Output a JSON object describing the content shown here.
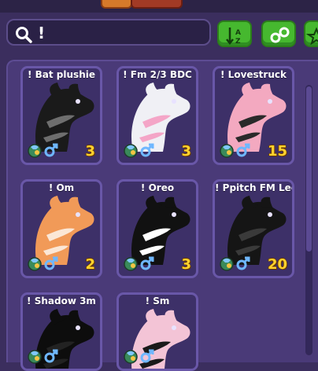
{
  "search": {
    "query": "!"
  },
  "pets": [
    {
      "name": "! Bat plushie",
      "count": "3",
      "pet_color": "#1a1a1a",
      "accent": "#6e6e6e"
    },
    {
      "name": "! Fm 2/3 BDC",
      "count": "3",
      "pet_color": "#f0f0f5",
      "accent": "#f4a5c7"
    },
    {
      "name": "! Lovestruck",
      "count": "15",
      "pet_color": "#f3a9c0",
      "accent": "#2a2a2a"
    },
    {
      "name": "! Om",
      "count": "2",
      "pet_color": "#f19a58",
      "accent": "#fbe7d6"
    },
    {
      "name": "! Oreo",
      "count": "3",
      "pet_color": "#111111",
      "accent": "#ffffff"
    },
    {
      "name": "! Ppitch FM Lege",
      "count": "20",
      "pet_color": "#151515",
      "accent": "#3a3a3a"
    },
    {
      "name": "! Shadow 3m",
      "count": "",
      "pet_color": "#0d0d0d",
      "accent": "#222222"
    },
    {
      "name": "! Sm",
      "count": "",
      "pet_color": "#f3c4d6",
      "accent": "#1a1a1a"
    }
  ],
  "colors": {
    "panel": "#4a3a78",
    "card_border": "#6957a8",
    "button_green": "#46b82f",
    "count_yellow": "#ffd22e"
  }
}
